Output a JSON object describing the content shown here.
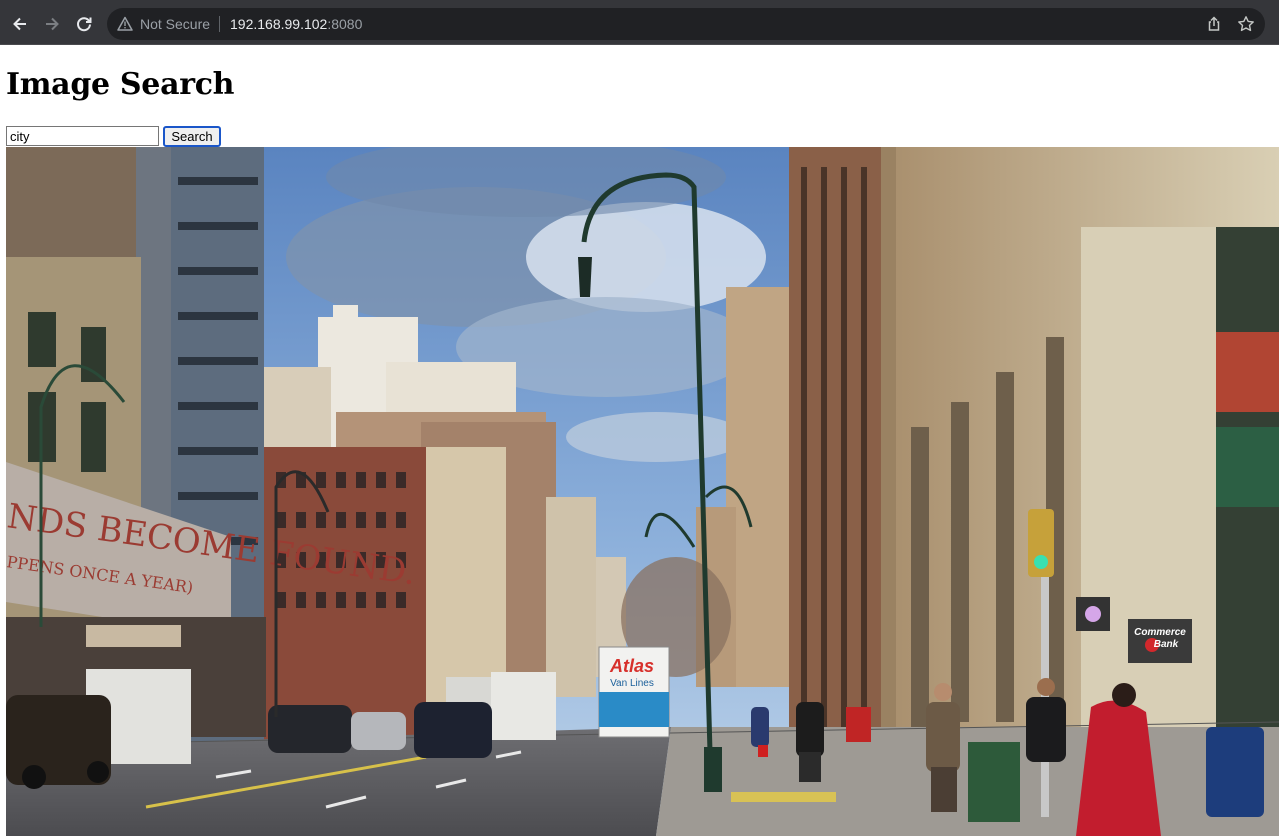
{
  "browser": {
    "security_label": "Not Secure",
    "url_host": "192.168.99.102",
    "url_port": ":8080"
  },
  "page": {
    "title": "Image Search"
  },
  "search": {
    "query": "city",
    "button_label": "Search"
  },
  "result": {
    "signs": {
      "awning_line1": "NDS BECOME FOUND.",
      "awning_line2": "PPENS ONCE A YEAR)",
      "truck_brand": "Atlas",
      "truck_sub": "Van Lines",
      "bank_line1": "Commerce",
      "bank_line2": "Bank"
    }
  }
}
